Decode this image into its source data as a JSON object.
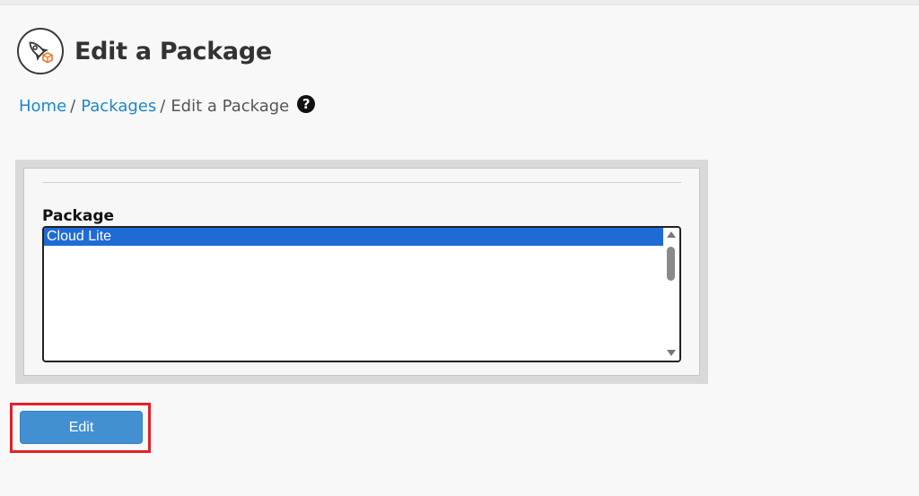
{
  "header": {
    "title": "Edit a Package",
    "icon": "rocket-package-icon"
  },
  "breadcrumb": {
    "items": [
      {
        "label": "Home",
        "link": true
      },
      {
        "label": "Packages",
        "link": true
      },
      {
        "label": "Edit a Package",
        "link": false
      }
    ],
    "separator": "/",
    "help_icon": "question-circle-icon"
  },
  "form": {
    "package_label": "Package",
    "packages": [
      {
        "label": "Cloud Lite",
        "selected": true
      }
    ]
  },
  "actions": {
    "edit_label": "Edit"
  },
  "colors": {
    "link": "#1b88c9",
    "selection": "#1f6bd6",
    "button": "#4290d2",
    "highlight": "#e3202a"
  }
}
